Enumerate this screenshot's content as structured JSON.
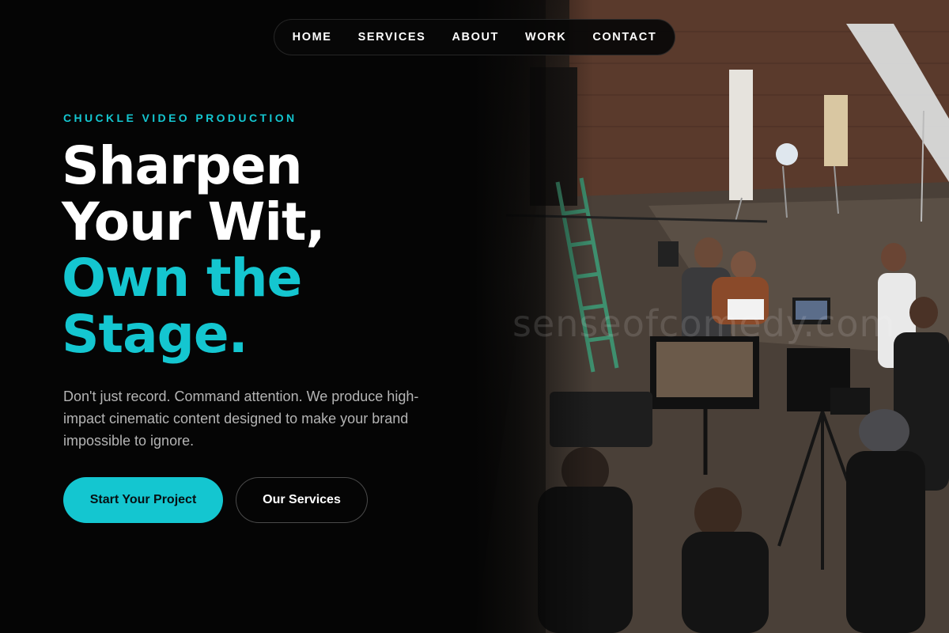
{
  "nav": {
    "items": [
      {
        "label": "HOME"
      },
      {
        "label": "SERVICES"
      },
      {
        "label": "ABOUT"
      },
      {
        "label": "WORK"
      },
      {
        "label": "CONTACT"
      }
    ]
  },
  "hero": {
    "eyebrow": "CHUCKLE VIDEO PRODUCTION",
    "headline": {
      "line1": "Sharpen",
      "line2": "Your Wit,",
      "line3": "Own the",
      "line4": "Stage."
    },
    "lede": "Don't just record. Command attention. We produce high-impact cinematic content designed to make your brand impossible to ignore.",
    "cta_primary": "Start Your Project",
    "cta_secondary": "Our Services",
    "watermark": "senseofcomedy.com"
  },
  "colors": {
    "accent": "#14c6d0",
    "background": "#050505",
    "text": "#ffffff",
    "muted_text": "#b4b4b4"
  }
}
